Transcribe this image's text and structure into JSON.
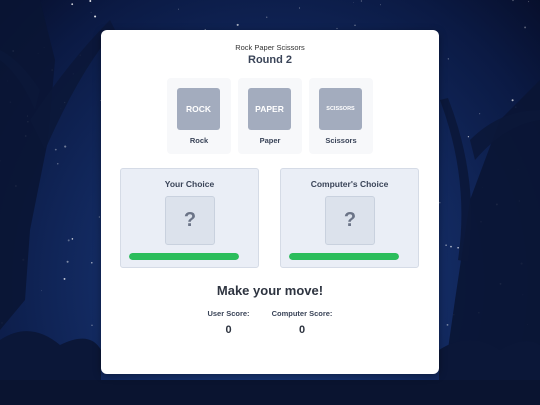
{
  "game": {
    "title": "Rock Paper Scissors",
    "round": "Round 2"
  },
  "options": [
    {
      "tile": "ROCK",
      "label": "Rock"
    },
    {
      "tile": "PAPER",
      "label": "Paper"
    },
    {
      "tile": "SCISSORS",
      "label": "Scissors"
    }
  ],
  "user_panel": {
    "title": "Your Choice",
    "choice": "?",
    "progress": 1.0
  },
  "computer_panel": {
    "title": "Computer's Choice",
    "choice": "?",
    "progress": 1.0
  },
  "status": "Make your move!",
  "scores": {
    "user_label": "User Score:",
    "user_value": "0",
    "computer_label": "Computer Score:",
    "computer_value": "0"
  },
  "colors": {
    "tile": "#a3acbe",
    "progress": "#2bbd5b",
    "panel": "#eaeef6"
  }
}
